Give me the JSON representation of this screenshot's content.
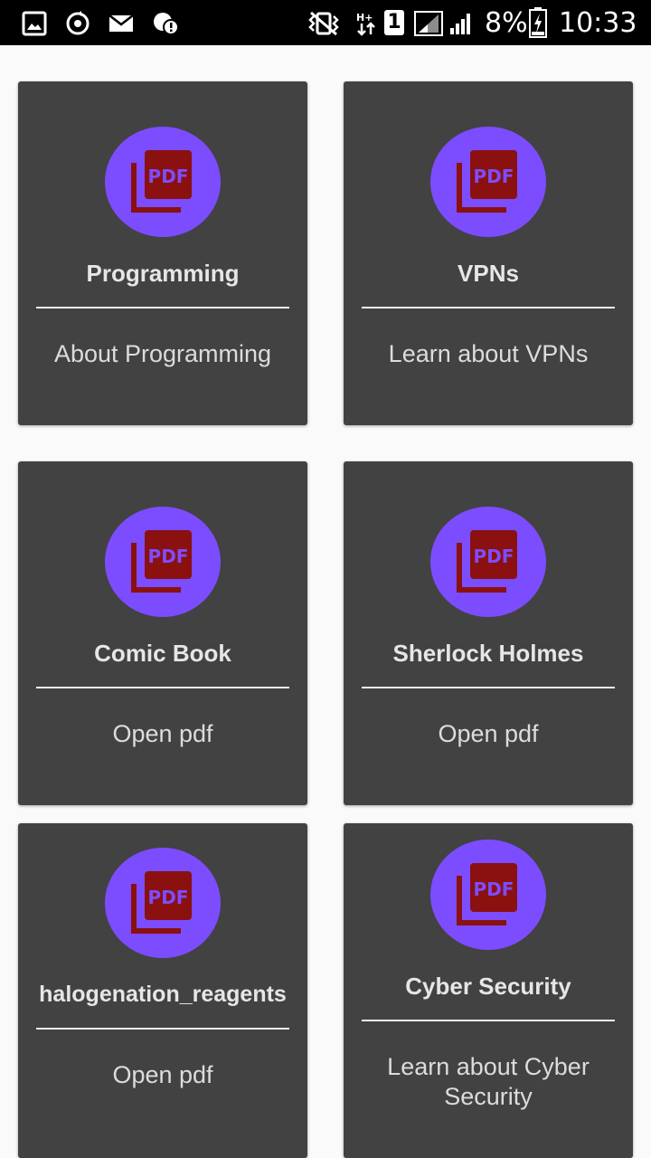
{
  "status_bar": {
    "battery_percent": "8%",
    "time": "10:33",
    "sim_slot": "1",
    "icons": [
      "gallery-icon",
      "sync-icon",
      "mail-icon",
      "alert-icon",
      "vibrate-icon",
      "data-arrows-icon",
      "signal-icon",
      "battery-icon"
    ]
  },
  "colors": {
    "card_bg": "#424242",
    "badge_bg": "#7c4dff",
    "pdf_icon": "#8b1010",
    "page_bg": "#fafafa"
  },
  "cards": [
    {
      "title": "Programming",
      "subtitle": "About Programming",
      "icon": "pdf-icon"
    },
    {
      "title": "VPNs",
      "subtitle": "Learn about VPNs",
      "icon": "pdf-icon"
    },
    {
      "title": "Comic Book",
      "subtitle": "Open pdf",
      "icon": "pdf-icon"
    },
    {
      "title": "Sherlock Holmes",
      "subtitle": "Open pdf",
      "icon": "pdf-icon"
    },
    {
      "title": "halogenation_reagents",
      "subtitle": "Open pdf",
      "icon": "pdf-icon"
    },
    {
      "title": "Cyber Security",
      "subtitle": "Learn about Cyber Security",
      "icon": "pdf-icon"
    }
  ]
}
